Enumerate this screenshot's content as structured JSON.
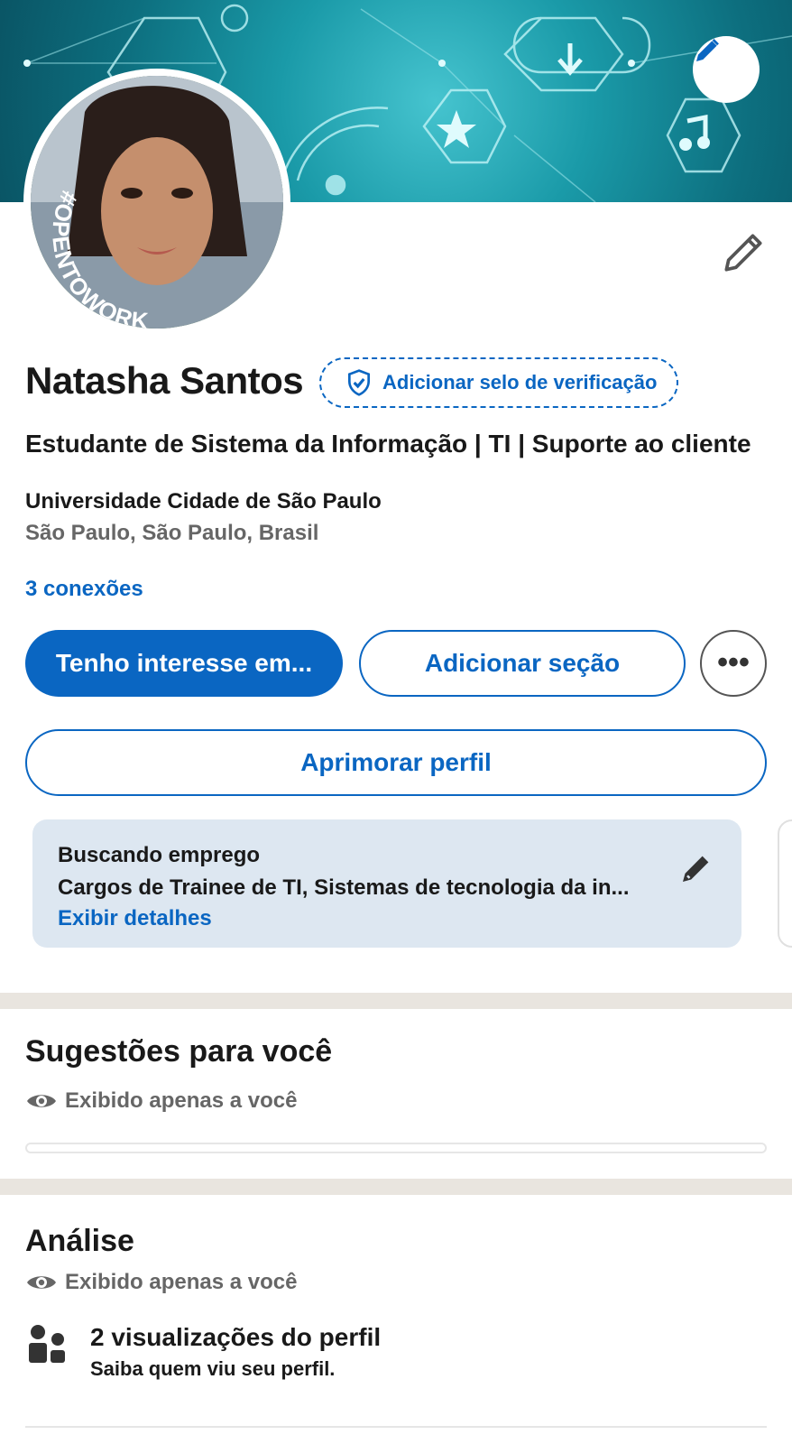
{
  "profile": {
    "name": "Natasha Santos",
    "verification_label": "Adicionar selo de verificação",
    "headline": "Estudante de Sistema da Informação | TI | Suporte ao cliente",
    "education": "Universidade Cidade de São Paulo",
    "location": "São Paulo, São Paulo, Brasil",
    "connections": "3 conexões",
    "avatar_frame_text": "#OPENTOWORK"
  },
  "actions": {
    "interest_label": "Tenho interesse em...",
    "add_section_label": "Adicionar seção",
    "more_label": "•••",
    "improve_label": "Aprimorar perfil"
  },
  "open_to_work": {
    "title": "Buscando emprego",
    "roles": "Cargos de Trainee de TI, Sistemas de tecnologia da in...",
    "details_link": "Exibir detalhes"
  },
  "suggestions": {
    "title": "Sugestões para você",
    "privacy": "Exibido apenas a você"
  },
  "analytics": {
    "title": "Análise",
    "privacy": "Exibido apenas a você",
    "views_title": "2 visualizações do perfil",
    "views_sub": "Saiba quem viu seu perfil."
  },
  "colors": {
    "accent": "#0a66c2",
    "banner": "#1a9aa8",
    "open_to_work_green": "#3e7a2c",
    "job_card_bg": "#dde7f1"
  },
  "icons": [
    "pencil-icon",
    "shield-check-icon",
    "eye-icon",
    "people-icon",
    "more-icon"
  ]
}
